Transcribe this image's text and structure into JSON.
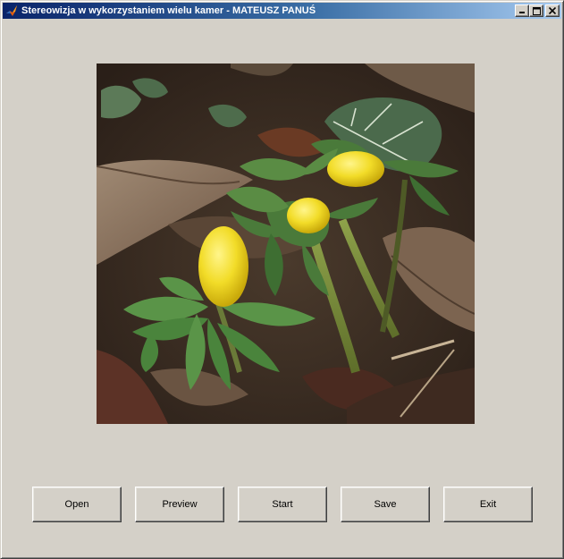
{
  "window": {
    "title": "Stereowizja w wykorzystaniem wielu kamer - MATEUSZ PANUŚ",
    "app_icon": "matlab-icon",
    "controls": {
      "minimize_icon": "minimize-icon",
      "maximize_icon": "maximize-icon",
      "close_icon": "close-icon"
    }
  },
  "image": {
    "subject": "yellow-flower-buds-photo"
  },
  "buttons": {
    "open": "Open",
    "preview": "Preview",
    "start": "Start",
    "save": "Save",
    "exit": "Exit"
  },
  "colors": {
    "face": "#d4d0c8",
    "title_active_start": "#0a246a",
    "title_active_end": "#a6caf0"
  }
}
